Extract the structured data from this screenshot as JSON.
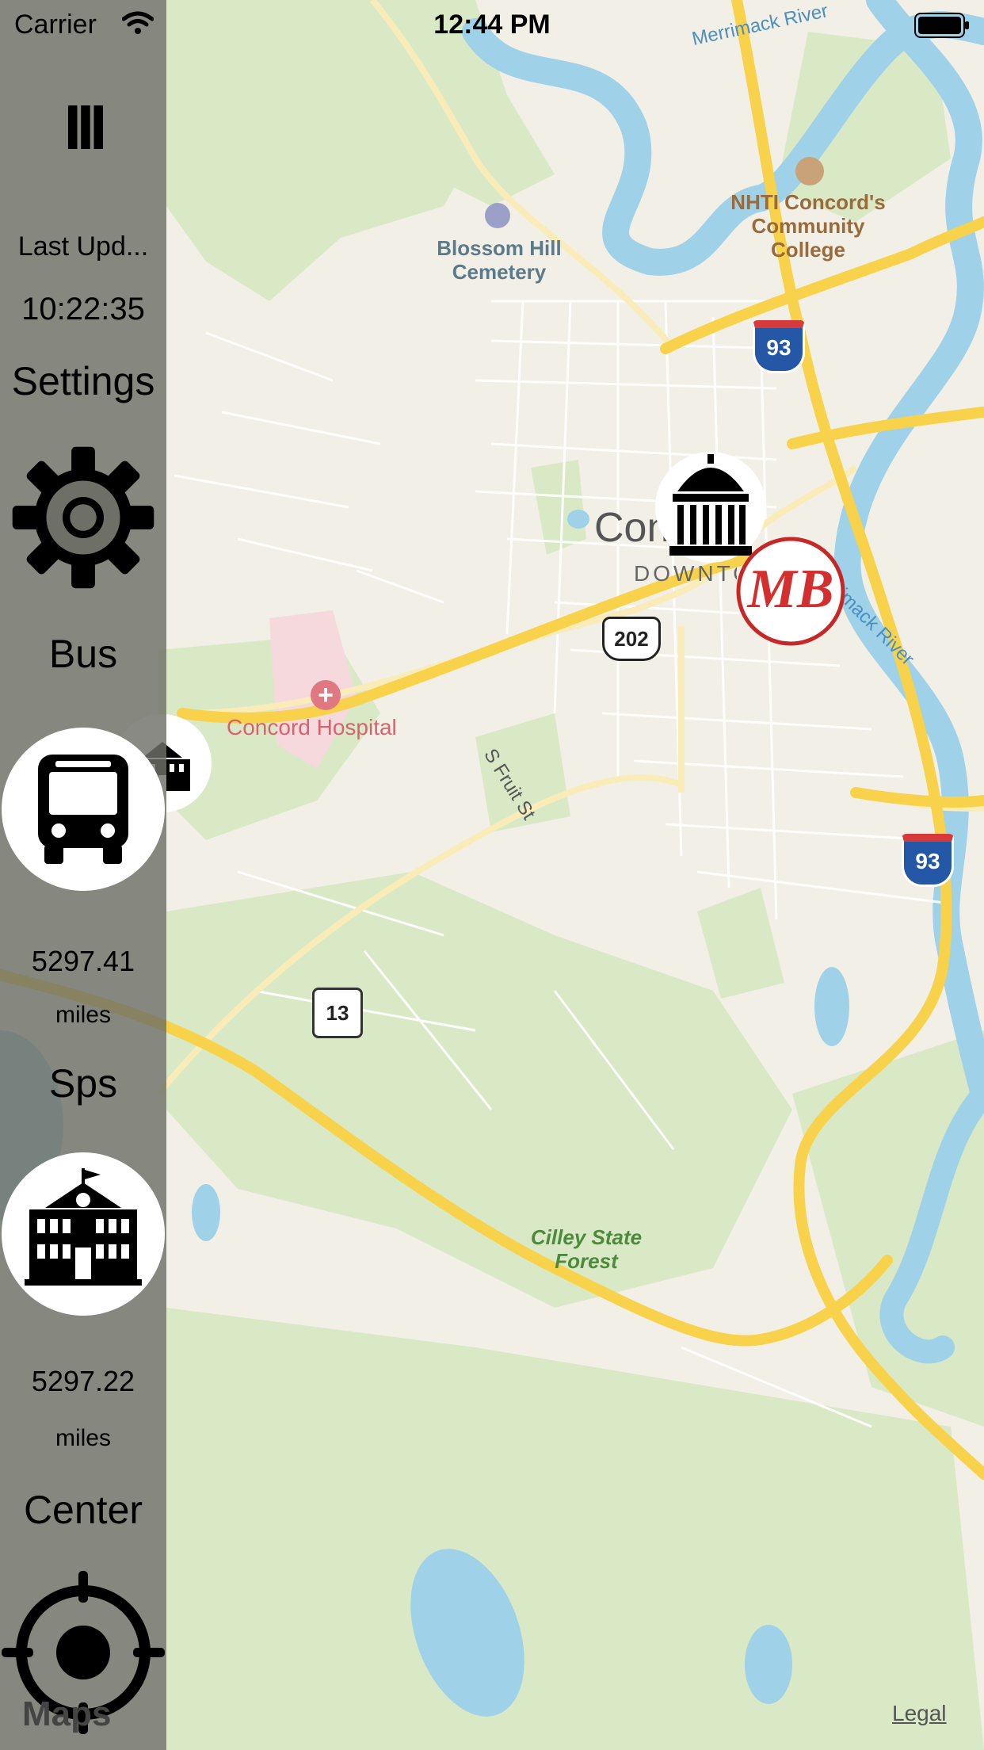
{
  "status_bar": {
    "carrier": "Carrier",
    "time": "12:44 PM"
  },
  "sidebar": {
    "menu_icon_label": "III",
    "last_update_label": "Last  Upd...",
    "last_update_time": "10:22:35",
    "settings_label": "Settings",
    "bus_label": "Bus",
    "bus_distance": "5297.41",
    "bus_unit": "miles",
    "sps_label": "Sps",
    "sps_distance": "5297.22",
    "sps_unit": "miles",
    "center_label": "Center"
  },
  "map": {
    "labels": {
      "river_top": "Merrimack River",
      "river_right": "Merrimack River",
      "cemetery": "Blossom Hill Cemetery",
      "college": "NHTI Concord's Community College",
      "city": "Concord",
      "downtown": "DOWNTOWN",
      "hospital": "Concord Hospital",
      "street": "S Fruit St",
      "forest": "Cilley State Forest",
      "route_202": "202",
      "route_93a": "93",
      "route_93b": "93",
      "route_13": "13"
    },
    "markers": [
      "capitol-icon",
      "market-basket-logo",
      "school-icon"
    ],
    "colors": {
      "land": "#f2efe6",
      "park": "#d6e8c4",
      "water": "#9fd1e8",
      "highway": "#f7d24a",
      "road": "#ffffff"
    }
  },
  "attribution": {
    "maps": "Maps",
    "legal": "Legal"
  }
}
